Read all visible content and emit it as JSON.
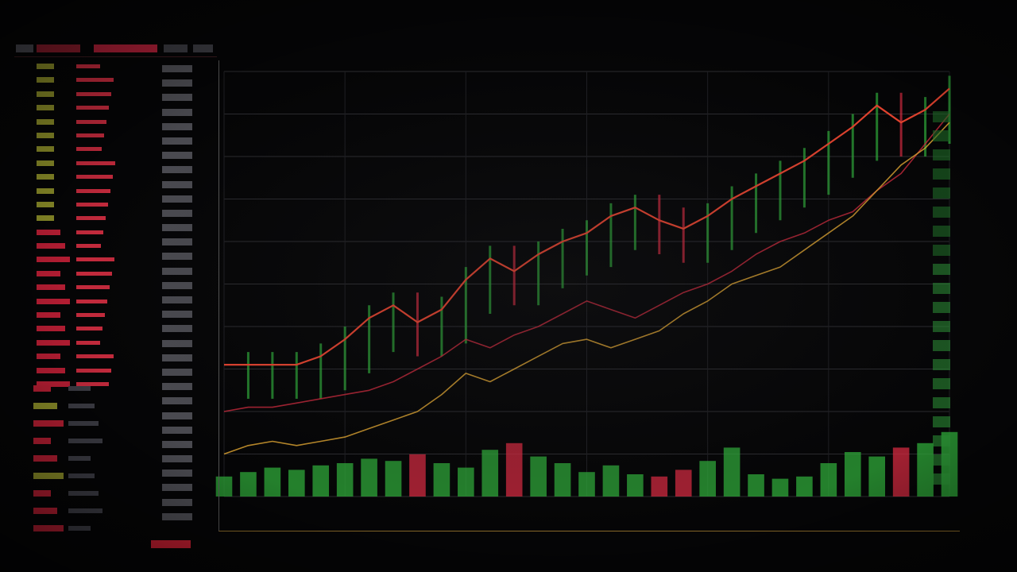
{
  "theme": {
    "background": "#050506",
    "up_color": "#2faa3a",
    "down_color": "#d42a40",
    "price_line_color": "#e0422e",
    "avg_line_color": "#c0283a",
    "accent_yellow": "#b8a428"
  },
  "orderbook": {
    "rows": 24,
    "lower_rows": 9
  },
  "chart_data": {
    "type": "line",
    "title": "",
    "xlabel": "",
    "ylabel": "",
    "grid": true,
    "legend": "none",
    "x": [
      0,
      1,
      2,
      3,
      4,
      5,
      6,
      7,
      8,
      9,
      10,
      11,
      12,
      13,
      14,
      15,
      16,
      17,
      18,
      19,
      20,
      21,
      22,
      23,
      24,
      25,
      26,
      27,
      28,
      29,
      30
    ],
    "ylim": [
      0,
      100
    ],
    "series": [
      {
        "values": [
          31,
          31,
          31,
          31,
          33,
          37,
          42,
          45,
          41,
          44,
          51,
          56,
          53,
          57,
          60,
          62,
          66,
          68,
          65,
          63,
          66,
          70,
          73,
          76,
          79,
          83,
          87,
          92,
          88,
          91,
          96
        ]
      },
      {
        "values": [
          20,
          21,
          21,
          22,
          23,
          24,
          25,
          27,
          30,
          33,
          37,
          35,
          38,
          40,
          43,
          46,
          44,
          42,
          45,
          48,
          50,
          53,
          57,
          60,
          62,
          65,
          67,
          72,
          76,
          83,
          90
        ]
      },
      {
        "values": [
          10,
          12,
          13,
          12,
          13,
          14,
          16,
          18,
          20,
          24,
          29,
          27,
          30,
          33,
          36,
          37,
          35,
          37,
          39,
          43,
          46,
          50,
          52,
          54,
          58,
          62,
          66,
          72,
          78,
          82,
          88
        ]
      }
    ],
    "volume": [
      18,
      22,
      26,
      24,
      28,
      30,
      34,
      32,
      38,
      30,
      26,
      42,
      48,
      36,
      30,
      22,
      28,
      20,
      18,
      24,
      32,
      44,
      20,
      16,
      18,
      30,
      40,
      36,
      44,
      48,
      58
    ]
  }
}
